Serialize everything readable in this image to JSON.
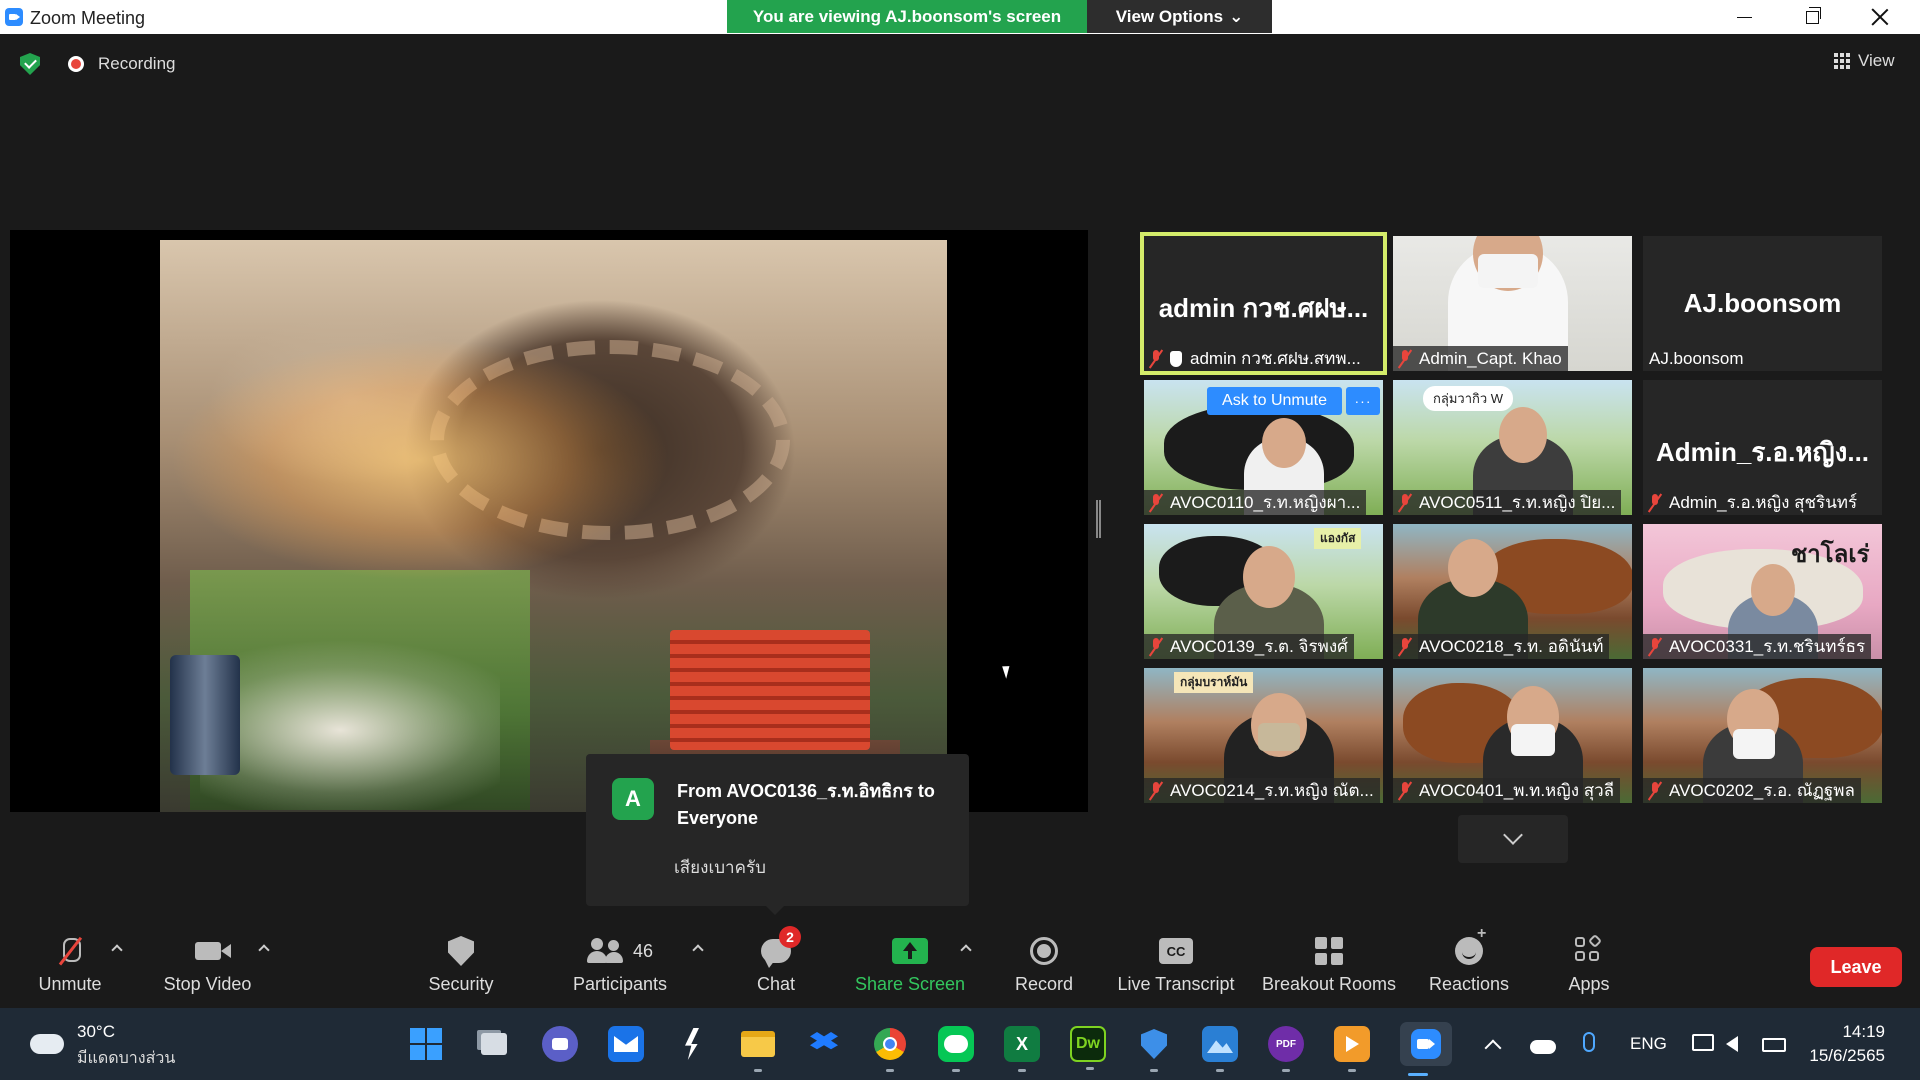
{
  "window": {
    "title": "Zoom Meeting",
    "viewing_banner": "You are viewing AJ.boonsom's screen",
    "view_options": "View Options",
    "view_options_chevron": "⌄"
  },
  "meeting_bar": {
    "recording": "Recording",
    "view": "View"
  },
  "gallery": {
    "tiles": [
      {
        "big_name": "admin กวช.ศฝษ...",
        "name": "admin กวช.ศฝษ.สทพ...",
        "muted": true,
        "hand_raised": true,
        "video": false,
        "active_speaker": true
      },
      {
        "name": "Admin_Capt. Khao",
        "muted": true,
        "video": true
      },
      {
        "big_name": "AJ.boonsom",
        "name": "AJ.boonsom",
        "muted": false,
        "video": false
      },
      {
        "name": "AVOC0110_ร.ท.หญิงผา...",
        "muted": true,
        "video": true
      },
      {
        "name": "AVOC0511_ร.ท.หญิง ปิย...",
        "muted": true,
        "video": true,
        "overlay_text": "กลุ่มวากิว W"
      },
      {
        "big_name": "Admin_ร.อ.หญิง...",
        "name": "Admin_ร.อ.หญิง สุชรินทร์",
        "muted": true,
        "video": false
      },
      {
        "name": "AVOC0139_ร.ต. จิรพงศ์",
        "muted": true,
        "video": true,
        "overlay_text": "แองกัส"
      },
      {
        "name": "AVOC0218_ร.ท. อดินันท์",
        "muted": true,
        "video": true
      },
      {
        "name": "AVOC0331_ร.ท.ชรินทร์ธร",
        "muted": true,
        "video": true,
        "overlay_text": "ชาโลเร่"
      },
      {
        "name": "AVOC0214_ร.ท.หญิง ณัต...",
        "muted": true,
        "video": true,
        "overlay_text": "กลุ่มบราห์มัน"
      },
      {
        "name": "AVOC0401_พ.ท.หญิง สุวลี",
        "muted": true,
        "video": true
      },
      {
        "name": "AVOC0202_ร.อ. ณัฏฐพล",
        "muted": true,
        "video": true
      }
    ],
    "ask_to_unmute": "Ask to Unmute",
    "more": "···"
  },
  "chat_toast": {
    "avatar_letter": "A",
    "from": "From AVOC0136_ร.ท.อิทธิกร to Everyone",
    "message": "เสียงเบาครับ"
  },
  "toolbar": {
    "unmute": "Unmute",
    "stop_video": "Stop Video",
    "security": "Security",
    "participants": "Participants",
    "participants_count": "46",
    "chat": "Chat",
    "chat_badge": "2",
    "share_screen": "Share Screen",
    "record": "Record",
    "live_transcript": "Live Transcript",
    "live_transcript_icon": "CC",
    "breakout_rooms": "Breakout Rooms",
    "reactions": "Reactions",
    "apps": "Apps",
    "leave": "Leave"
  },
  "taskbar": {
    "weather_temp": "30°C",
    "weather_desc": "มีแดดบางส่วน",
    "language": "ENG",
    "time": "14:19",
    "date": "15/6/2565",
    "apps": [
      "start",
      "task-view",
      "teams-chat",
      "mail",
      "app-bolt",
      "file-explorer",
      "dropbox",
      "chrome",
      "line",
      "excel",
      "dreamweaver",
      "security-app",
      "photos",
      "pdf-app",
      "media-app",
      "zoom"
    ]
  },
  "colors": {
    "zoom_blue": "#2d8cff",
    "viewing_green": "#23a34e",
    "active_speaker_outline": "#d4ec6a",
    "leave_red": "#e02828",
    "mute_red": "#e8453c"
  }
}
